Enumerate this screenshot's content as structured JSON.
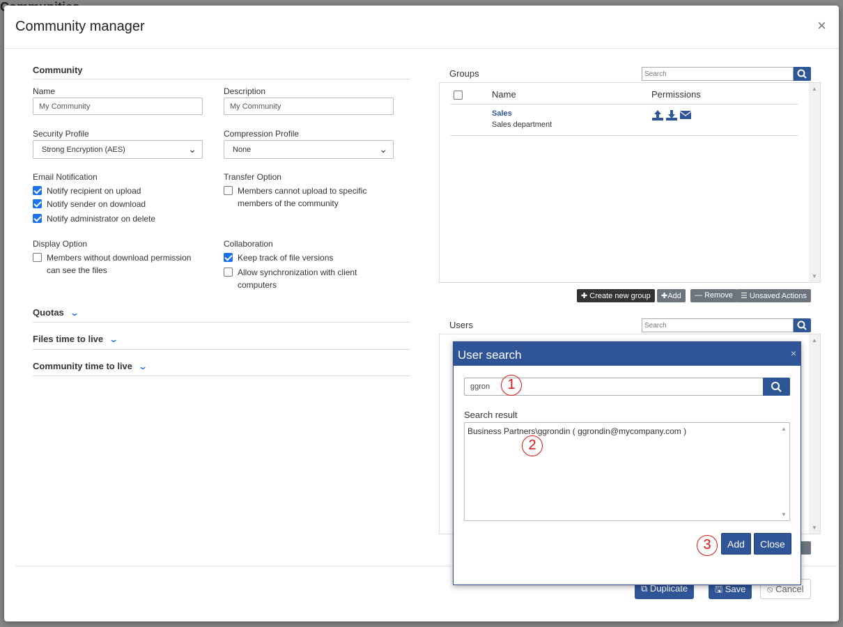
{
  "background": {
    "title": "Communities"
  },
  "modal": {
    "title": "Community manager",
    "close_symbol": "×"
  },
  "community": {
    "section_title": "Community",
    "name_label": "Name",
    "name_value": "My Community",
    "description_label": "Description",
    "description_value": "My Community",
    "security_profile_label": "Security Profile",
    "security_profile_value": "Strong Encryption (AES)",
    "compression_profile_label": "Compression Profile",
    "compression_profile_value": "None",
    "email_notification_label": "Email Notification",
    "email_options": [
      {
        "label": "Notify recipient on upload",
        "checked": true
      },
      {
        "label": "Notify sender on download",
        "checked": true
      },
      {
        "label": "Notify administrator on delete",
        "checked": true
      }
    ],
    "transfer_option_label": "Transfer Option",
    "transfer_option_line1": "Members cannot upload to specific",
    "transfer_option_line2": "members of the community",
    "display_option_label": "Display Option",
    "display_option_line1": "Members without download permission",
    "display_option_line2": "can see the files",
    "collaboration_label": "Collaboration",
    "keep_track_label": "Keep track of file versions",
    "allow_sync_line1": "Allow synchronization with client",
    "allow_sync_line2": "computers",
    "quotas_label": "Quotas",
    "files_ttl_label": "Files time to live",
    "community_ttl_label": "Community time to live"
  },
  "groups": {
    "title": "Groups",
    "search_placeholder": "Search",
    "col_name": "Name",
    "col_permissions": "Permissions",
    "rows": [
      {
        "name": "Sales",
        "description": "Sales department"
      }
    ],
    "buttons": {
      "create": "Create new group",
      "add": "Add",
      "remove": "Remove",
      "unsaved": "Unsaved Actions"
    }
  },
  "users": {
    "title": "Users",
    "search_placeholder": "Search"
  },
  "footer": {
    "duplicate": "Duplicate",
    "save": "Save",
    "cancel": "Cancel"
  },
  "user_search": {
    "title": "User search",
    "close_symbol": "×",
    "query": "ggron",
    "result_label": "Search result",
    "result_item": "Business Partners\\ggrondin ( ggrondin@mycompany.com )",
    "add": "Add",
    "close": "Close",
    "markers": [
      "1",
      "2",
      "3"
    ]
  },
  "colors": {
    "primary": "#2f5597",
    "checkbox": "#1a73e8",
    "annotation": "#e01010"
  }
}
